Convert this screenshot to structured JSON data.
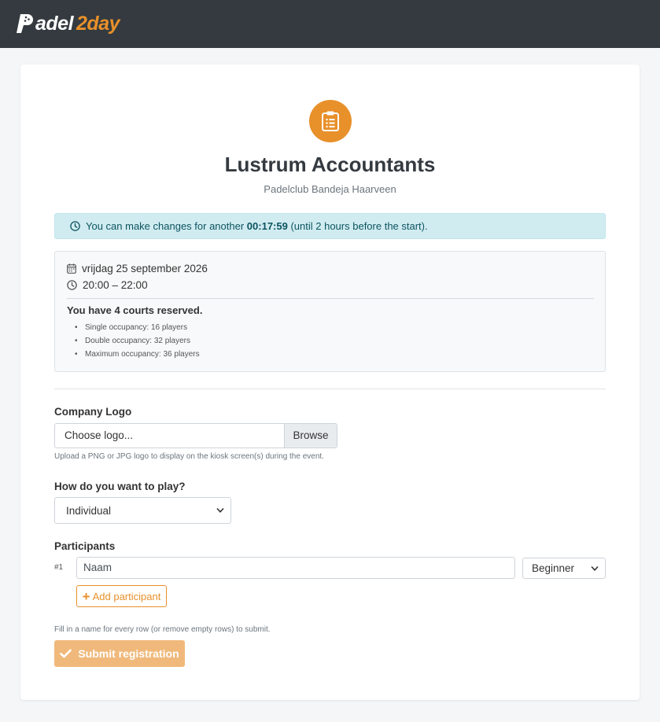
{
  "brand": {
    "part1": "adel",
    "part2": "2day"
  },
  "event": {
    "title": "Lustrum Accountants",
    "venue": "Padelclub Bandeja Haarveen"
  },
  "alert": {
    "prefix": "You can make changes for another",
    "countdown": "00:17:59",
    "suffix": "(until 2 hours before the start)."
  },
  "info": {
    "date": "vrijdag 25 september 2026",
    "time": "20:00 – 22:00",
    "courts": "You have 4 courts reserved.",
    "occupancy": [
      "Single occupancy: 16 players",
      "Double occupancy: 32 players",
      "Maximum occupancy: 36 players"
    ]
  },
  "logo": {
    "label": "Company Logo",
    "placeholder": "Choose logo...",
    "browse": "Browse",
    "help": "Upload a PNG or JPG logo to display on the kiosk screen(s) during the event."
  },
  "play": {
    "label": "How do you want to play?",
    "selected": "Individual"
  },
  "participants": {
    "label": "Participants",
    "rows": [
      {
        "number": "#1",
        "name_placeholder": "Naam",
        "level": "Beginner"
      }
    ],
    "add": "Add participant",
    "help": "Fill in a name for every row (or remove empty rows) to submit."
  },
  "submit": {
    "label": "Submit registration"
  },
  "colors": {
    "accent": "#e8902a",
    "navbar": "#343a40",
    "alert_bg": "#d1ecf1",
    "alert_text": "#0c5460",
    "submit_disabled": "#f0b97b"
  }
}
